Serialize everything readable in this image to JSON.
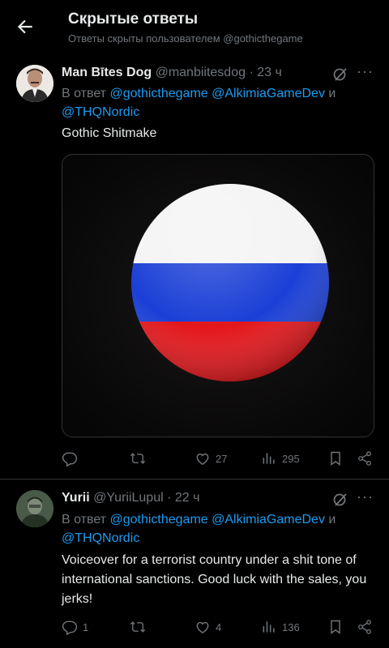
{
  "header": {
    "title": "Скрытые ответы",
    "subtitle": "Ответы скрыты пользователем @gothicthegame"
  },
  "tweets": [
    {
      "name": "Man Bītes Dog",
      "handle": "@manbiitesdog",
      "time": "· 23 ч",
      "reply_prefix": "В ответ",
      "mentions": [
        "@gothicthegame",
        "@AlkimiaGameDev",
        "@THQNordic"
      ],
      "conjunction": "и",
      "text": "Gothic Shitmake",
      "media": "russian-flag-circle",
      "stats": {
        "replies": "",
        "retweets": "",
        "likes": "27",
        "views": "295"
      }
    },
    {
      "name": "Yurii",
      "handle": "@YuriiLupul",
      "time": "· 22 ч",
      "reply_prefix": "В ответ",
      "mentions": [
        "@gothicthegame",
        "@AlkimiaGameDev",
        "@THQNordic"
      ],
      "conjunction": "и",
      "text": "Voiceover for a terrorist country under a shit tone of international sanctions. Good luck with the sales, you jerks!",
      "stats": {
        "replies": "1",
        "retweets": "",
        "likes": "4",
        "views": "136"
      }
    }
  ],
  "colors": {
    "background": "#000000",
    "text": "#e7e9ea",
    "muted": "#71767b",
    "link": "#1d9bf0",
    "divider": "#2f3336"
  },
  "icons": [
    "back-arrow-icon",
    "grok-icon",
    "more-icon",
    "reply-icon",
    "retweet-icon",
    "like-icon",
    "views-icon",
    "bookmark-icon",
    "share-icon"
  ]
}
